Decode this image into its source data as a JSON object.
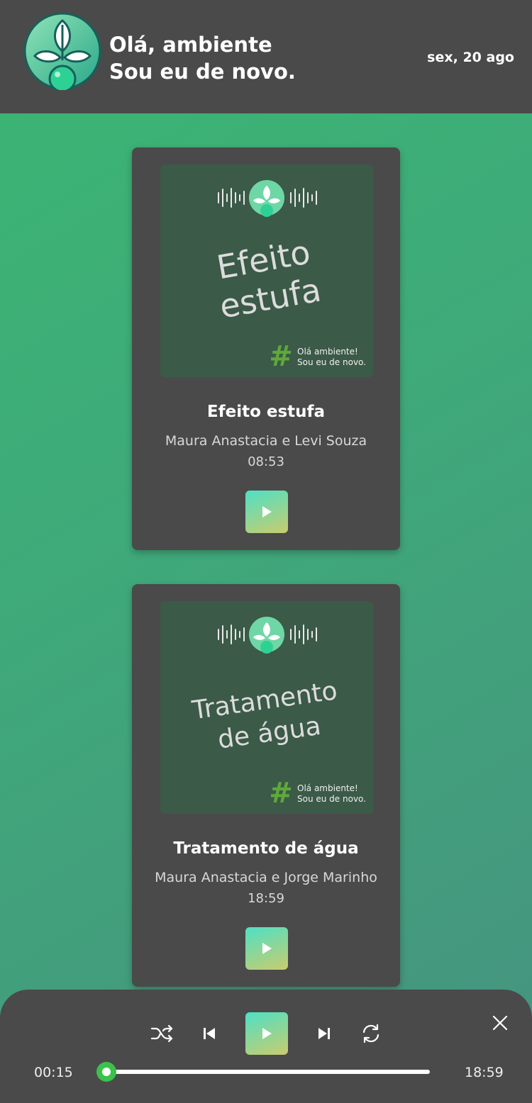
{
  "header": {
    "greeting_line1": "Olá, ambiente",
    "greeting_line2": "Sou eu de novo.",
    "date": "sex, 20 ago",
    "logo_icon": "plant-flask-logo"
  },
  "episodes": [
    {
      "cover_title_line1": "Efeito",
      "cover_title_line2": "estufa",
      "cover_tag_line1": "Olá ambiente!",
      "cover_tag_line2": "Sou eu de novo.",
      "title": "Efeito estufa",
      "authors": "Maura Anastacia e Levi Souza",
      "duration": "08:53",
      "play_icon": "play-icon"
    },
    {
      "cover_title_line1": "Tratamento",
      "cover_title_line2": "de água",
      "cover_tag_line1": "Olá ambiente!",
      "cover_tag_line2": "Sou eu de novo.",
      "title": "Tratamento de água",
      "authors": "Maura Anastacia e Jorge Marinho",
      "duration": "18:59",
      "play_icon": "play-icon"
    }
  ],
  "player": {
    "current_time": "00:15",
    "total_time": "18:59",
    "progress_fraction": 0.013,
    "icons": [
      "shuffle-icon",
      "previous-icon",
      "play-icon",
      "next-icon",
      "repeat-icon",
      "close-icon"
    ],
    "accent_color": "#3ac24a"
  },
  "colors": {
    "header_bg": "#4a4a4a",
    "card_bg": "#4a4a4a",
    "cover_bg": "#3b5a48",
    "hash_green": "#5fa83a"
  }
}
